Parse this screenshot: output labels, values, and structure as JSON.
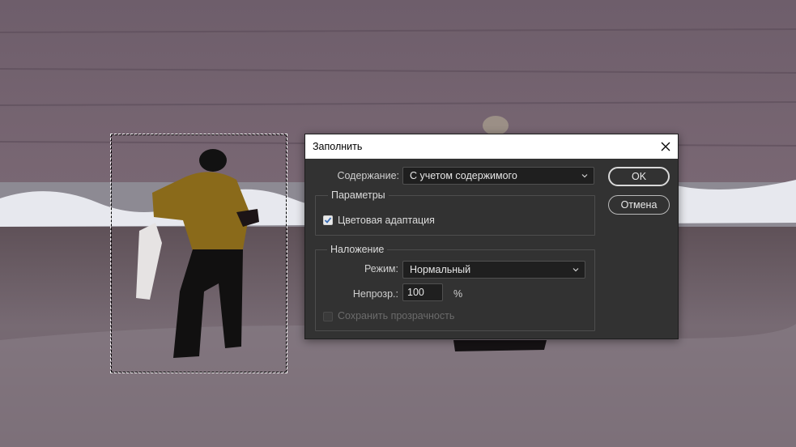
{
  "dialog": {
    "title": "Заполнить",
    "content_label": "Содержание:",
    "content_value": "С учетом содержимого",
    "ok_label": "OK",
    "cancel_label": "Отмена",
    "options": {
      "legend": "Параметры",
      "color_adaptation_label": "Цветовая адаптация",
      "color_adaptation_checked": true
    },
    "blending": {
      "legend": "Наложение",
      "mode_label": "Режим:",
      "mode_value": "Нормальный",
      "opacity_label": "Непрозр.:",
      "opacity_value": "100",
      "opacity_unit": "%",
      "preserve_transparency_label": "Сохранить прозрачность",
      "preserve_transparency_checked": false,
      "preserve_transparency_enabled": false
    }
  },
  "icons": {
    "close": "close-icon",
    "dropdown": "chevron-down-icon",
    "checkmark": "check-icon"
  },
  "colors": {
    "dialog_bg": "#323232",
    "field_bg": "#1f1f1f",
    "titlebar_bg": "#ffffff"
  }
}
